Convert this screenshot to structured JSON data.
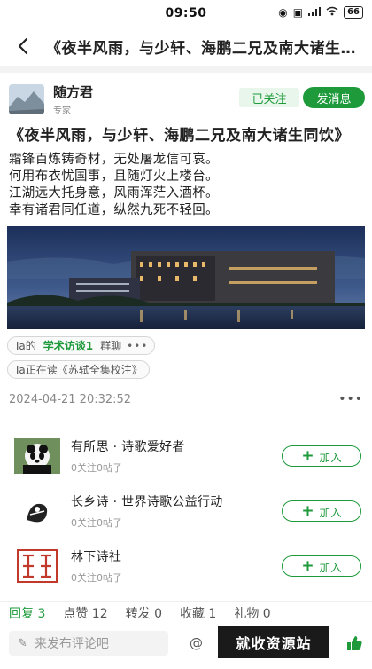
{
  "status_bar": {
    "time": "09:50",
    "battery": "66"
  },
  "nav": {
    "title": "《夜半风雨，与少轩、海鹏二兄及南大诸生同饮》"
  },
  "author": {
    "name": "随方君",
    "role": "专家",
    "follow_label": "已关注",
    "message_label": "发消息"
  },
  "post": {
    "title": "《夜半风雨，与少轩、海鹏二兄及南大诸生同饮》",
    "lines": [
      "霜锋百炼铸奇材，无处屠龙信可哀。",
      "何用布衣忧国事，且随灯火上楼台。",
      "江湖远大托身意，风雨浑茫入酒杯。",
      "幸有诸君同任道，纵然九死不轻回。"
    ],
    "date": "2024-04-21 20:32:52"
  },
  "chips": {
    "group_prefix": "Ta的",
    "group_name": "学术访谈1",
    "group_suffix": "群聊",
    "more": "•••",
    "reading": "Ta正在读《苏轼全集校注》"
  },
  "groups": [
    {
      "name": "有所思 · 诗歌爱好者",
      "stats": "0关注0帖子",
      "join_label": "加入"
    },
    {
      "name": "长乡诗 · 世界诗歌公益行动",
      "stats": "0关注0帖子",
      "join_label": "加入"
    },
    {
      "name": "林下诗社",
      "stats": "0关注0帖子",
      "join_label": "加入"
    }
  ],
  "stats": {
    "replies": "回复 3",
    "likes": "点赞 12",
    "shares": "转发 0",
    "favorites": "收藏 1",
    "gifts": "礼物 0"
  },
  "comment": {
    "placeholder": "来发布评论吧",
    "watermark": "就收资源站"
  },
  "colors": {
    "accent": "#1e9a3b"
  }
}
